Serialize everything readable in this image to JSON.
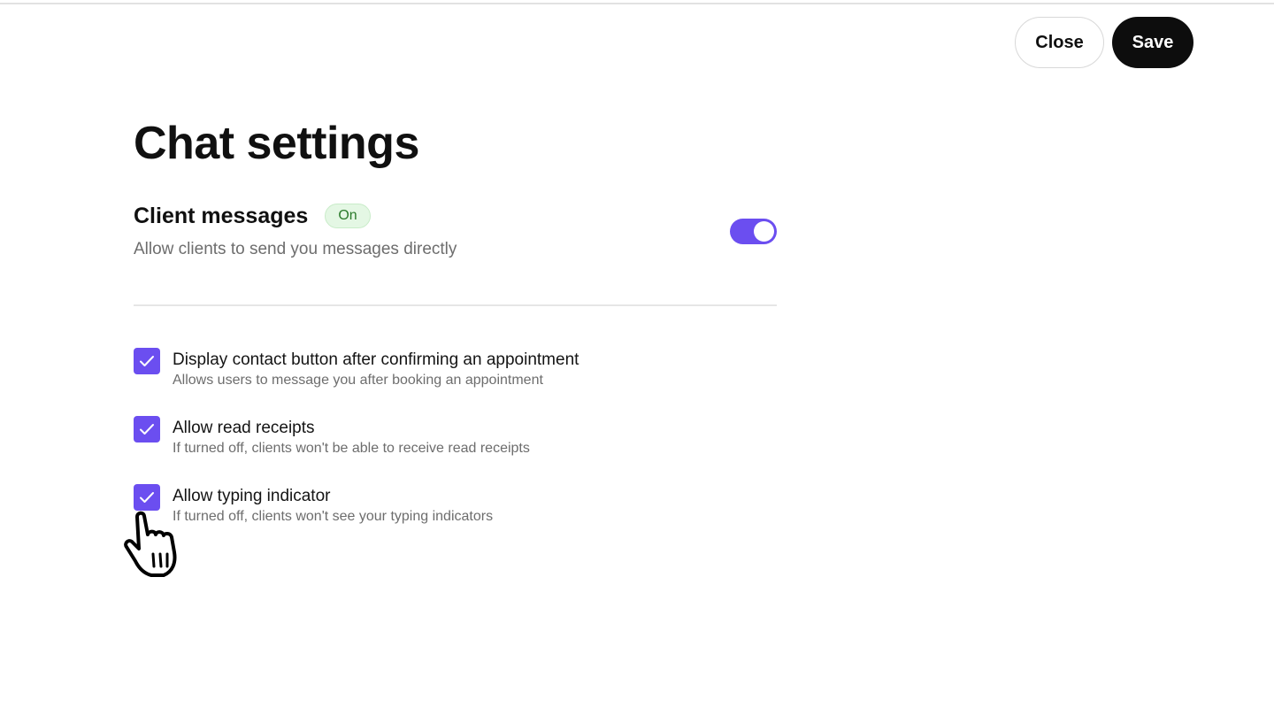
{
  "header": {
    "close_label": "Close",
    "save_label": "Save"
  },
  "page": {
    "title": "Chat settings"
  },
  "client_messages": {
    "title": "Client messages",
    "status_badge": "On",
    "description": "Allow clients to send you messages directly",
    "toggle_on": true
  },
  "options": [
    {
      "label": "Display contact button after confirming an appointment",
      "description": "Allows users to message you after booking an appointment",
      "checked": true
    },
    {
      "label": "Allow read receipts",
      "description": "If turned off, clients won't be able to receive read receipts",
      "checked": true
    },
    {
      "label": "Allow typing indicator",
      "description": "If turned off, clients won't see your typing indicators",
      "checked": true
    }
  ],
  "colors": {
    "accent": "#6b4ef0",
    "primary_button": "#0d0d0d",
    "badge_bg": "#e4f7e4",
    "badge_text": "#2a7a2a"
  },
  "icons": {
    "checkbox": "check-icon",
    "cursor": "hand-pointer-icon"
  }
}
